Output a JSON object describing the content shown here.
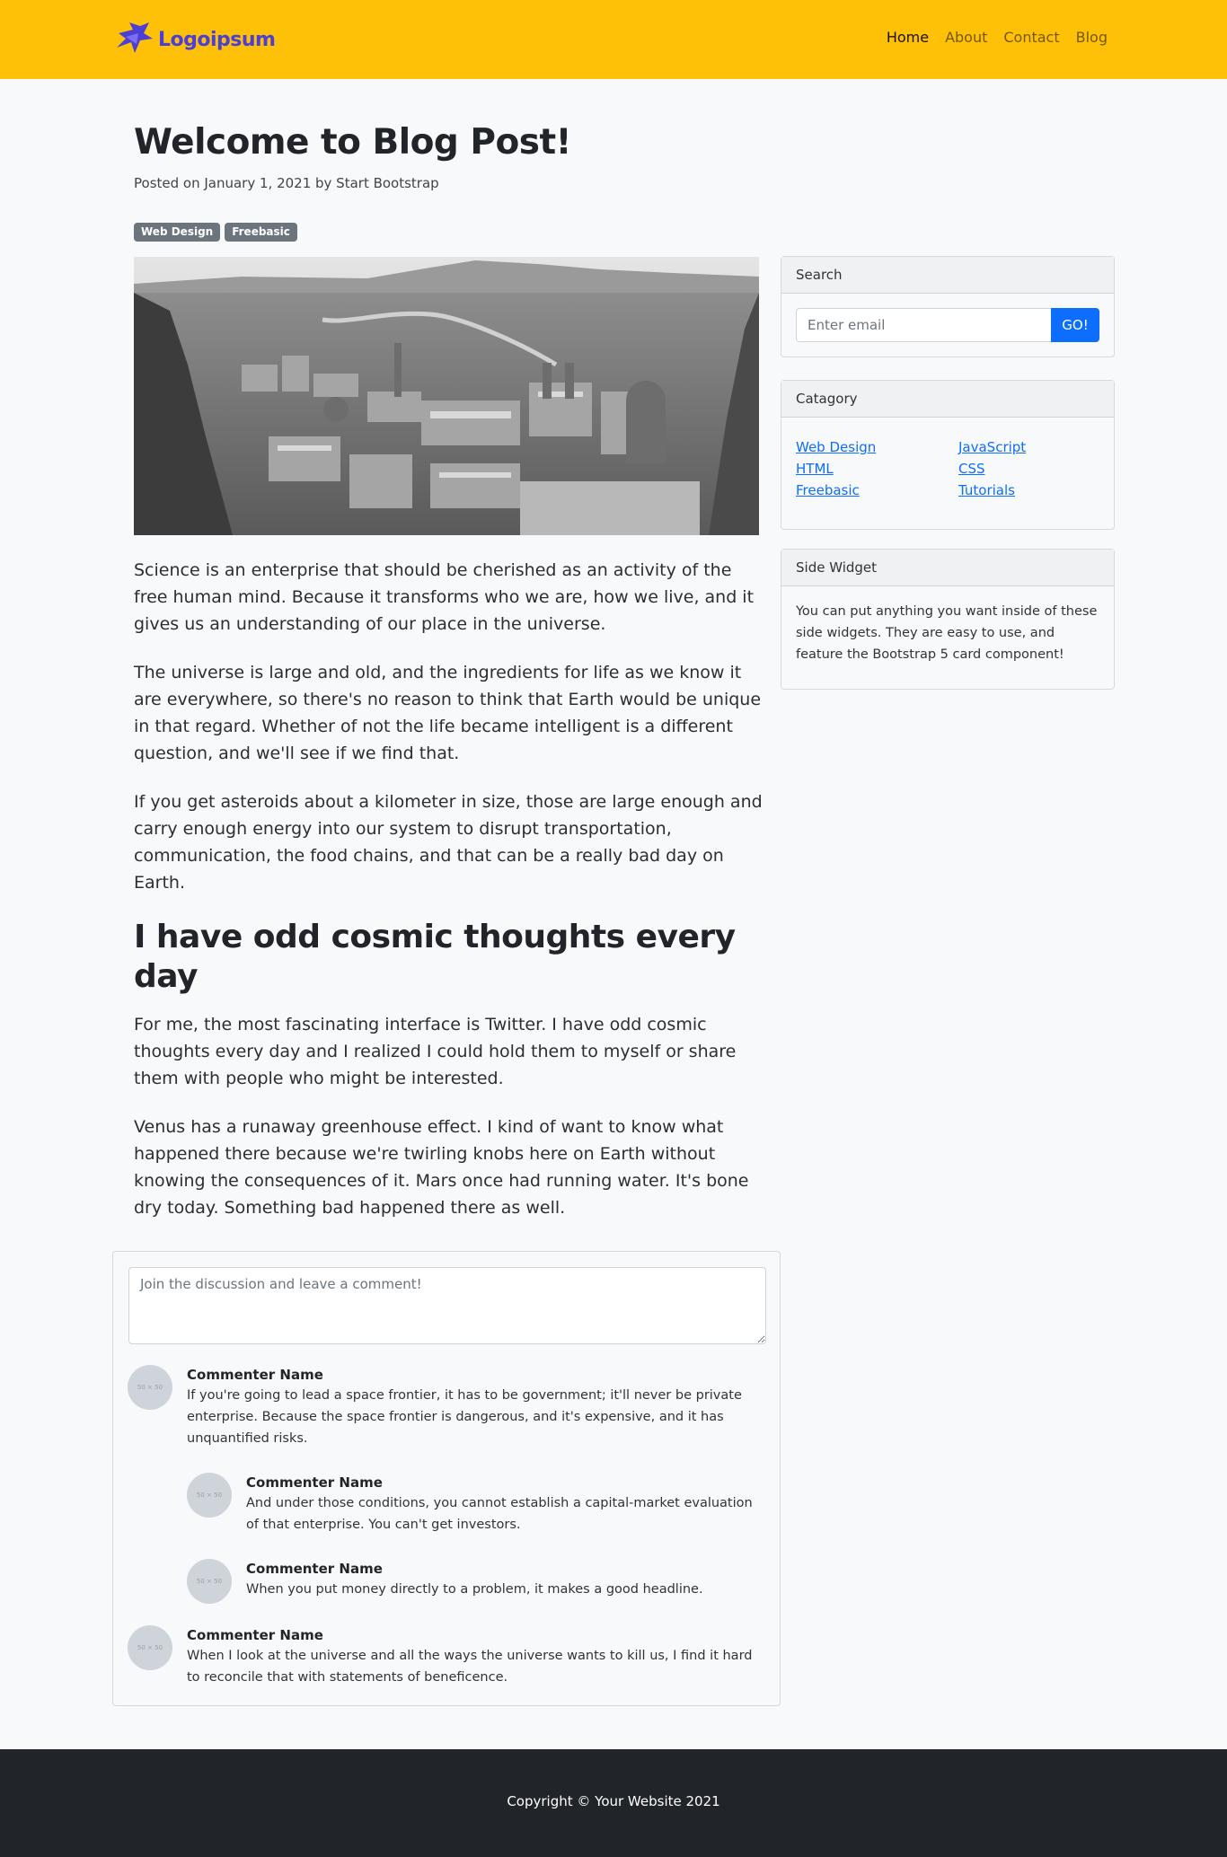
{
  "brand": {
    "name": "Logoipsum",
    "icon": "logo-icon",
    "color": "#4b3fd6"
  },
  "nav": {
    "items": [
      {
        "label": "Home",
        "active": true
      },
      {
        "label": "About",
        "active": false
      },
      {
        "label": "Contact",
        "active": false
      },
      {
        "label": "Blog",
        "active": false
      }
    ]
  },
  "post": {
    "title": "Welcome to Blog Post!",
    "meta": "Posted on January 1, 2021 by Start Bootstrap",
    "badges": [
      "Web Design",
      "Freebasic"
    ],
    "paragraphs_top": [
      "Science is an enterprise that should be cherished as an activity of the free human mind. Because it transforms who we are, how we live, and it gives us an understanding of our place in the universe.",
      "The universe is large and old, and the ingredients for life as we know it are everywhere, so there's no reason to think that Earth would be unique in that regard. Whether of not the life became intelligent is a different question, and we'll see if we find that.",
      "If you get asteroids about a kilometer in size, those are large enough and carry enough energy into our system to disrupt transportation, communication, the food chains, and that can be a really bad day on Earth."
    ],
    "subheading": "I have odd cosmic thoughts every day",
    "paragraphs_bottom": [
      "For me, the most fascinating interface is Twitter. I have odd cosmic thoughts every day and I realized I could hold them to myself or share them with people who might be interested.",
      "Venus has a runaway greenhouse effect. I kind of want to know what happened there because we're twirling knobs here on Earth without knowing the consequences of it. Mars once had running water. It's bone dry today. Something bad happened there as well."
    ]
  },
  "sidebar": {
    "search": {
      "title": "Search",
      "placeholder": "Enter email",
      "button": "GO!"
    },
    "category": {
      "title": "Catagory",
      "links": [
        "Web Design",
        "JavaScript",
        "HTML",
        "CSS",
        "Freebasic",
        "Tutorials"
      ]
    },
    "widget": {
      "title": "Side Widget",
      "text": "You can put anything you want inside of these side widgets. They are easy to use, and feature the Bootstrap 5 card component!"
    }
  },
  "comments": {
    "placeholder": "Join the discussion and leave a comment!",
    "avatar_text": "50 × 50",
    "items": [
      {
        "name": "Commenter Name",
        "text": "If you're going to lead a space frontier, it has to be government; it'll never be private enterprise. Because the space frontier is dangerous, and it's expensive, and it has unquantified risks."
      },
      {
        "name": "Commenter Name",
        "text": "And under those conditions, you cannot establish a capital-market evaluation of that enterprise. You can't get investors."
      },
      {
        "name": "Commenter Name",
        "text": "When you put money directly to a problem, it makes a good headline."
      },
      {
        "name": "Commenter Name",
        "text": "When I look at the universe and all the ways the universe wants to kill us, I find it hard to reconcile that with statements of beneficence."
      }
    ]
  },
  "footer": {
    "copyright": "Copyright © Your Website 2021"
  },
  "colors": {
    "navbar": "#ffc107",
    "primary": "#0d6efd",
    "badge": "#6c757d",
    "footer": "#212529"
  }
}
